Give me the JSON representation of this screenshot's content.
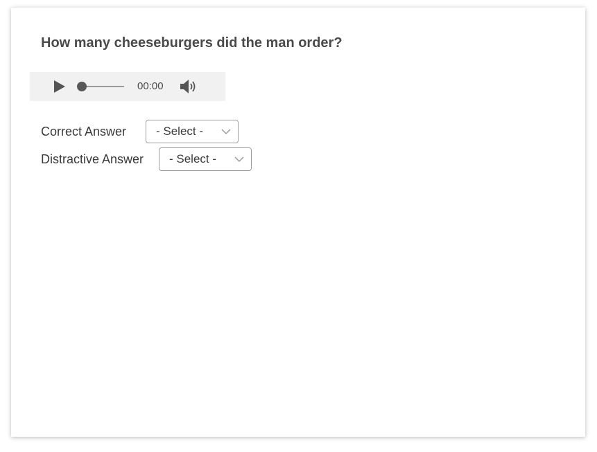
{
  "question": {
    "text": "How many cheeseburgers did the man order?"
  },
  "audio_player": {
    "time": "00:00",
    "progress": 0,
    "play_icon": "play-icon",
    "volume_icon": "volume-icon"
  },
  "answers": [
    {
      "label": "Correct Answer",
      "selected": "- Select -"
    },
    {
      "label": "Distractive Answer",
      "selected": "- Select -"
    }
  ],
  "colors": {
    "text": "#3a3a3a",
    "heading": "#4a4a4a",
    "player_bg": "#f1f1f1",
    "border": "#9b9b9b"
  }
}
